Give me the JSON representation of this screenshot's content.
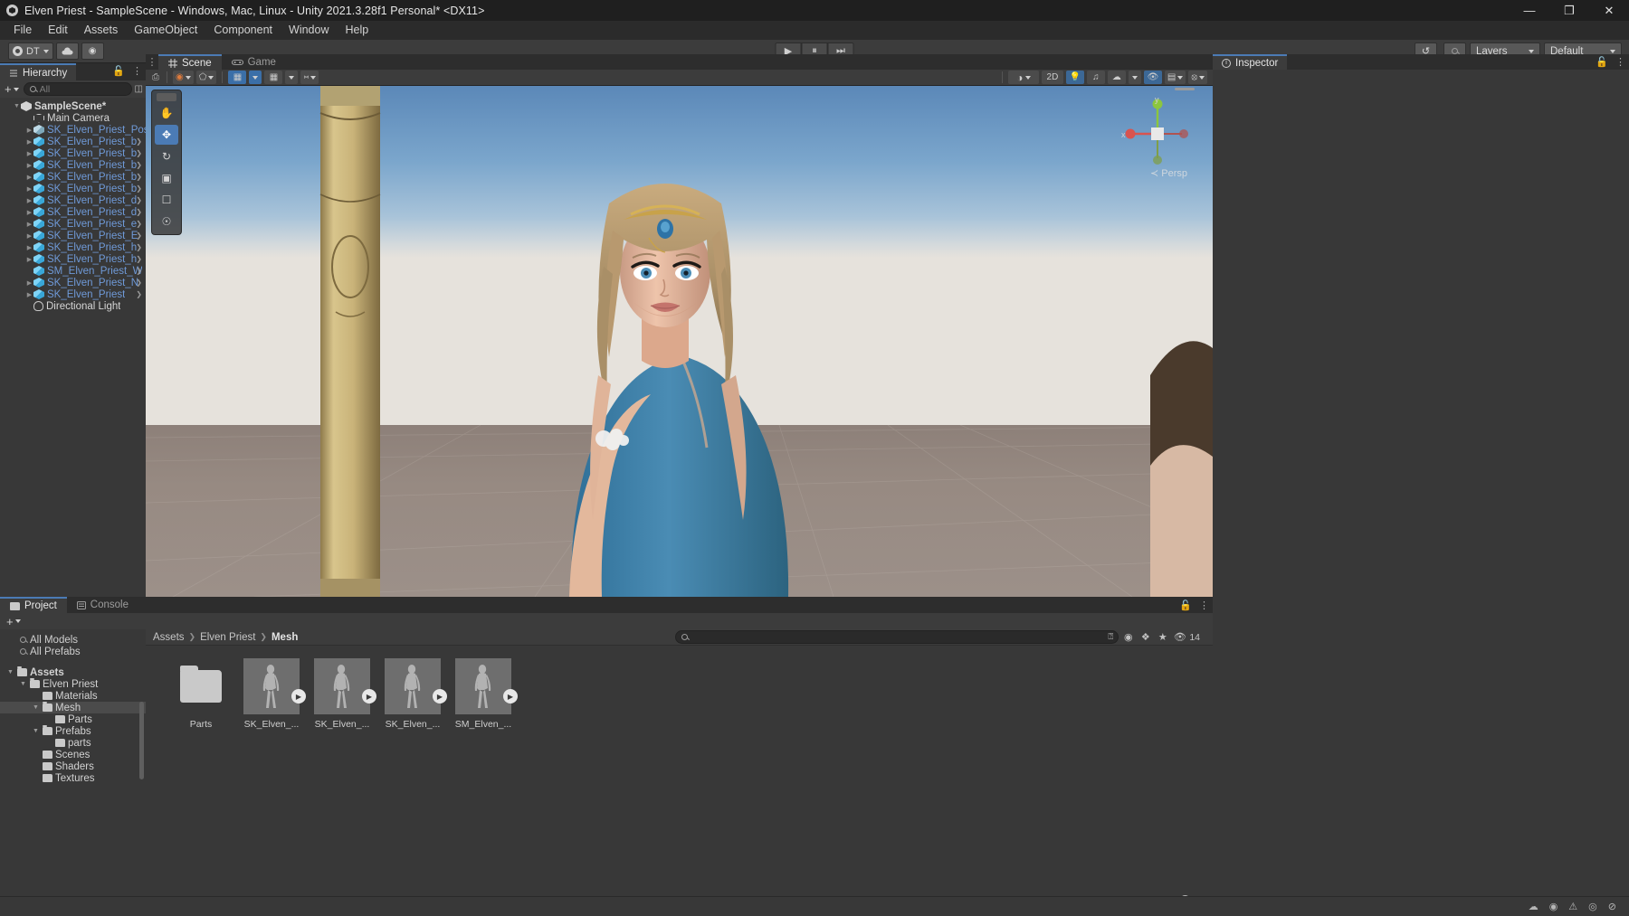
{
  "window": {
    "title": "Elven Priest - SampleScene - Windows, Mac, Linux - Unity 2021.3.28f1 Personal* <DX11>",
    "minimize": "—",
    "maximize": "❐",
    "close": "✕"
  },
  "menubar": {
    "items": [
      "File",
      "Edit",
      "Assets",
      "GameObject",
      "Component",
      "Window",
      "Help"
    ]
  },
  "toolbar": {
    "account_label": "DT",
    "cloud_icon": "cloud-icon",
    "settings_icon": "gear-icon",
    "play_icon": "▶",
    "pause_icon": "⏸",
    "step_icon": "⏭",
    "history_icon": "↺",
    "search_icon": "search-icon",
    "layers_label": "Layers",
    "layout_label": "Default"
  },
  "hierarchy": {
    "tab_label": "Hierarchy",
    "lock_icon": "lock-icon",
    "menu_icon": "kebab-icon",
    "add_label": "+",
    "search_placeholder": "All",
    "items": [
      {
        "label": "SampleScene*",
        "type": "scene",
        "depth": 0,
        "twisty": "▼",
        "color": "white",
        "bold": true,
        "chev": false
      },
      {
        "label": "Main Camera",
        "type": "camera",
        "depth": 1,
        "twisty": "",
        "color": "white",
        "bold": false,
        "chev": false
      },
      {
        "label": "SK_Elven_Priest_Pos",
        "type": "prefab",
        "depth": 1,
        "twisty": "▶",
        "color": "blue",
        "bold": false,
        "chev": false
      },
      {
        "label": "SK_Elven_Priest_b",
        "type": "cube",
        "depth": 1,
        "twisty": "▶",
        "color": "blue",
        "bold": false,
        "chev": true
      },
      {
        "label": "SK_Elven_Priest_b",
        "type": "cube",
        "depth": 1,
        "twisty": "▶",
        "color": "blue",
        "bold": false,
        "chev": true
      },
      {
        "label": "SK_Elven_Priest_b",
        "type": "cube",
        "depth": 1,
        "twisty": "▶",
        "color": "blue",
        "bold": false,
        "chev": true
      },
      {
        "label": "SK_Elven_Priest_b",
        "type": "cube",
        "depth": 1,
        "twisty": "▶",
        "color": "blue",
        "bold": false,
        "chev": true
      },
      {
        "label": "SK_Elven_Priest_b",
        "type": "cube",
        "depth": 1,
        "twisty": "▶",
        "color": "blue",
        "bold": false,
        "chev": true
      },
      {
        "label": "SK_Elven_Priest_d",
        "type": "cube",
        "depth": 1,
        "twisty": "▶",
        "color": "blue",
        "bold": false,
        "chev": true
      },
      {
        "label": "SK_Elven_Priest_d",
        "type": "cube",
        "depth": 1,
        "twisty": "▶",
        "color": "blue",
        "bold": false,
        "chev": true
      },
      {
        "label": "SK_Elven_Priest_e",
        "type": "cube",
        "depth": 1,
        "twisty": "▶",
        "color": "blue",
        "bold": false,
        "chev": true
      },
      {
        "label": "SK_Elven_Priest_E",
        "type": "cube",
        "depth": 1,
        "twisty": "▶",
        "color": "blue",
        "bold": false,
        "chev": true
      },
      {
        "label": "SK_Elven_Priest_h",
        "type": "cube",
        "depth": 1,
        "twisty": "▶",
        "color": "blue",
        "bold": false,
        "chev": true
      },
      {
        "label": "SK_Elven_Priest_h",
        "type": "cube",
        "depth": 1,
        "twisty": "▶",
        "color": "blue",
        "bold": false,
        "chev": true
      },
      {
        "label": "SM_Elven_Priest_W",
        "type": "cube",
        "depth": 1,
        "twisty": "",
        "color": "blue",
        "bold": false,
        "chev": true
      },
      {
        "label": "SK_Elven_Priest_N",
        "type": "cube",
        "depth": 1,
        "twisty": "▶",
        "color": "blue",
        "bold": false,
        "chev": true
      },
      {
        "label": "SK_Elven_Priest",
        "type": "cube",
        "depth": 1,
        "twisty": "▶",
        "color": "blue",
        "bold": false,
        "chev": true
      },
      {
        "label": "Directional Light",
        "type": "light",
        "depth": 1,
        "twisty": "",
        "color": "white",
        "bold": false,
        "chev": false
      }
    ]
  },
  "scene": {
    "tabs": [
      {
        "label": "Scene",
        "icon": "grid-icon",
        "active": true
      },
      {
        "label": "Game",
        "icon": "gamepad-icon",
        "active": false
      }
    ],
    "menu_icon": "kebab-icon",
    "toolbar_left": [
      {
        "name": "transform-tool-pivot",
        "glyph": "◉",
        "state": "normal"
      },
      {
        "name": "transform-tool-handle",
        "glyph": "▢",
        "state": "normal"
      },
      {
        "name": "grid-snap-toggle",
        "glyph": "⌗",
        "state": "on"
      },
      {
        "name": "grid-visibility",
        "glyph": "⋯",
        "state": "normal"
      },
      {
        "name": "audio-levels",
        "glyph": "‖",
        "state": "normal"
      }
    ],
    "toolbar_right": [
      {
        "name": "shading-mode",
        "glyph": "◑",
        "state": "normal"
      },
      {
        "name": "2d-toggle",
        "glyph": "2D",
        "state": "normal"
      },
      {
        "name": "scene-lighting-toggle",
        "glyph": "☀",
        "state": "on"
      },
      {
        "name": "audio-toggle",
        "glyph": "♪",
        "state": "normal"
      },
      {
        "name": "fx-toggle",
        "glyph": "☁",
        "state": "normal"
      },
      {
        "name": "scene-visibility-toggle",
        "glyph": "◉",
        "state": "on"
      },
      {
        "name": "camera-settings",
        "glyph": "▤",
        "state": "normal"
      },
      {
        "name": "gizmos-toggle",
        "glyph": "⊕",
        "state": "normal"
      }
    ],
    "tools": [
      {
        "name": "view-tool",
        "glyph": "✋",
        "selected": false
      },
      {
        "name": "move-tool",
        "glyph": "✥",
        "selected": true
      },
      {
        "name": "rotate-tool",
        "glyph": "↻",
        "selected": false
      },
      {
        "name": "scale-tool",
        "glyph": "⧉",
        "selected": false
      },
      {
        "name": "rect-tool",
        "glyph": "▣",
        "selected": false
      },
      {
        "name": "transform-tool",
        "glyph": "☉",
        "selected": false
      }
    ],
    "gizmo": {
      "x_label": "x",
      "y_label": "y",
      "persp_label": "≺ Persp"
    }
  },
  "inspector": {
    "tab_label": "Inspector",
    "info_icon": "info-icon",
    "lock_icon": "lock-icon",
    "menu_icon": "kebab-icon"
  },
  "project": {
    "tabs": [
      {
        "label": "Project",
        "icon": "folder-icon",
        "active": true
      },
      {
        "label": "Console",
        "icon": "console-icon",
        "active": false
      }
    ],
    "lock_icon": "lock-icon",
    "menu_icon": "kebab-icon",
    "add_label": "+",
    "saved_searches": [
      "All Models",
      "All Prefabs"
    ],
    "tree": [
      {
        "label": "Assets",
        "depth": 0,
        "twisty": "▼",
        "open": true,
        "bold": true,
        "selected": false
      },
      {
        "label": "Elven Priest",
        "depth": 1,
        "twisty": "▼",
        "open": true,
        "bold": false,
        "selected": false
      },
      {
        "label": "Materials",
        "depth": 2,
        "twisty": "",
        "open": false,
        "bold": false,
        "selected": false
      },
      {
        "label": "Mesh",
        "depth": 2,
        "twisty": "▼",
        "open": true,
        "bold": false,
        "selected": true
      },
      {
        "label": "Parts",
        "depth": 3,
        "twisty": "",
        "open": false,
        "bold": false,
        "selected": false
      },
      {
        "label": "Prefabs",
        "depth": 2,
        "twisty": "▼",
        "open": true,
        "bold": false,
        "selected": false
      },
      {
        "label": "parts",
        "depth": 3,
        "twisty": "",
        "open": false,
        "bold": false,
        "selected": false
      },
      {
        "label": "Scenes",
        "depth": 2,
        "twisty": "",
        "open": false,
        "bold": false,
        "selected": false
      },
      {
        "label": "Shaders",
        "depth": 2,
        "twisty": "",
        "open": false,
        "bold": false,
        "selected": false
      },
      {
        "label": "Textures",
        "depth": 2,
        "twisty": "",
        "open": false,
        "bold": false,
        "selected": false
      }
    ],
    "breadcrumb": [
      "Assets",
      "Elven Priest",
      "Mesh"
    ],
    "search_placeholder": "",
    "search_value": "",
    "filter_icons": [
      {
        "name": "search-by-type-icon",
        "glyph": "◔"
      },
      {
        "name": "search-by-label-icon",
        "glyph": "◆"
      },
      {
        "name": "favorites-star-icon",
        "glyph": "★"
      },
      {
        "name": "hidden-packages-icon",
        "glyph": "◎"
      }
    ],
    "item_count": "14",
    "assets": [
      {
        "name": "Parts",
        "type": "folder",
        "has_play": false
      },
      {
        "name": "SK_Elven_...",
        "type": "model",
        "has_play": true
      },
      {
        "name": "SK_Elven_...",
        "type": "model",
        "has_play": true
      },
      {
        "name": "SK_Elven_...",
        "type": "model",
        "has_play": true
      },
      {
        "name": "SM_Elven_...",
        "type": "model",
        "has_play": true
      }
    ]
  },
  "statusbar": {
    "icons": [
      {
        "name": "collab-icon",
        "glyph": "☁"
      },
      {
        "name": "cloud-build-icon",
        "glyph": "☉"
      },
      {
        "name": "accessibility-icon",
        "glyph": "⚠"
      },
      {
        "name": "notification-icon",
        "glyph": "◎"
      },
      {
        "name": "error-icon",
        "glyph": "⊘"
      }
    ]
  },
  "colors": {
    "accent_blue": "#4b7bb5",
    "hierarchy_blue_text": "#6f9ad8",
    "panel_bg": "#383838",
    "toolbar_bg": "#3c3c3c",
    "tabbar_bg": "#2d2d2d",
    "titlebar_bg": "#1f1f1f"
  }
}
